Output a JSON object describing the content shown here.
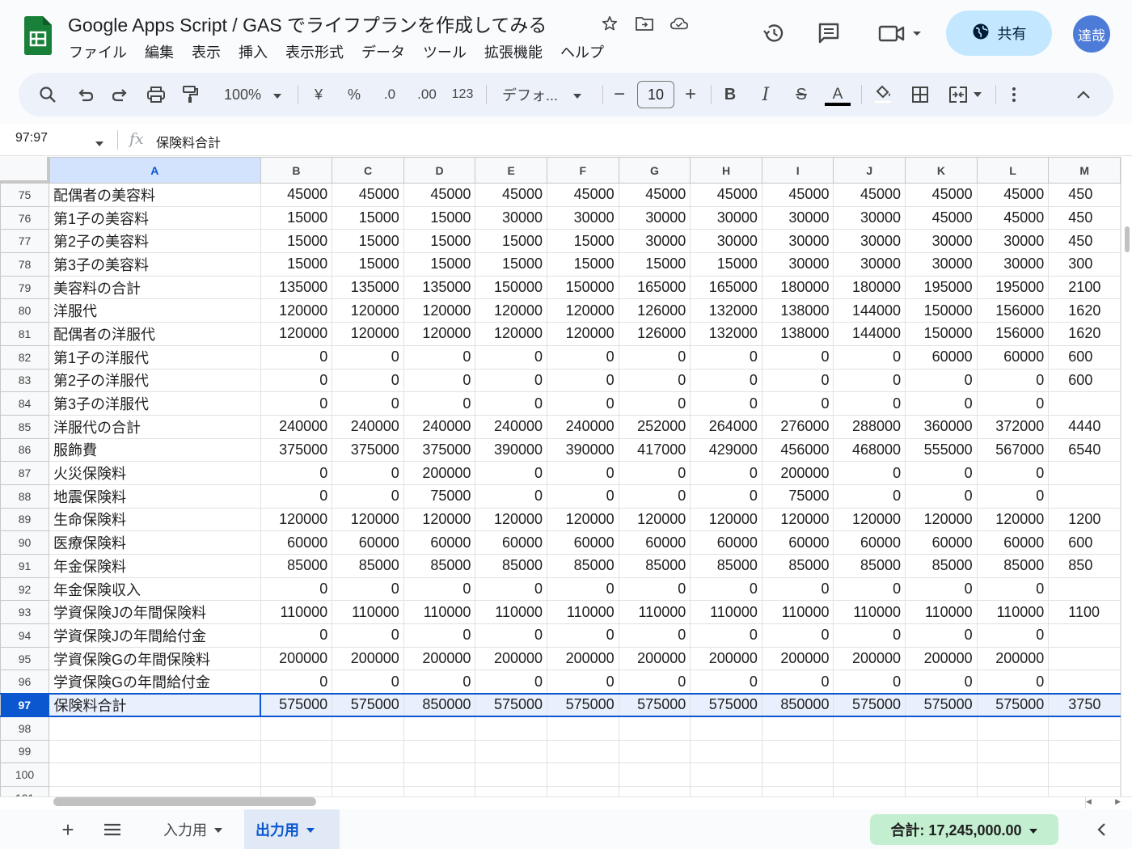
{
  "app": {
    "title": "Google Apps Script / GAS でライフプランを作成してみる",
    "accent_color": "#0b57d0",
    "logo_color": "#188038"
  },
  "menu": [
    "ファイル",
    "編集",
    "表示",
    "挿入",
    "表示形式",
    "データ",
    "ツール",
    "拡張機能",
    "ヘルプ"
  ],
  "header": {
    "share_label": "共有",
    "avatar_text": "達哉",
    "icons": [
      "star-icon",
      "move-to-folder-icon",
      "cloud-saved-icon",
      "history-icon",
      "comment-icon",
      "meet-icon",
      "globe-icon"
    ]
  },
  "toolbar": {
    "zoom": "100%",
    "currency": "¥",
    "percent": "%",
    "dec_decrease": ".0",
    "dec_increase": ".00",
    "number_format": "123",
    "font_family": "デフォ...",
    "font_size": "10",
    "minus": "−",
    "plus": "+",
    "bold": "B",
    "italic": "I",
    "strike": "S",
    "text_color_label": "A"
  },
  "formula_bar": {
    "name_box": "97:97",
    "fx_label": "fx",
    "content": "保険料合計"
  },
  "grid": {
    "columns": [
      "A",
      "B",
      "C",
      "D",
      "E",
      "F",
      "G",
      "H",
      "I",
      "J",
      "K",
      "L",
      "M"
    ],
    "rows": [
      {
        "n": "75",
        "label": "配偶者の美容料",
        "values": [
          "45000",
          "45000",
          "45000",
          "45000",
          "45000",
          "45000",
          "45000",
          "45000",
          "45000",
          "45000",
          "45000",
          "450"
        ]
      },
      {
        "n": "76",
        "label": "第1子の美容料",
        "values": [
          "15000",
          "15000",
          "15000",
          "30000",
          "30000",
          "30000",
          "30000",
          "30000",
          "30000",
          "45000",
          "45000",
          "450"
        ]
      },
      {
        "n": "77",
        "label": "第2子の美容料",
        "values": [
          "15000",
          "15000",
          "15000",
          "15000",
          "15000",
          "30000",
          "30000",
          "30000",
          "30000",
          "30000",
          "30000",
          "450"
        ]
      },
      {
        "n": "78",
        "label": "第3子の美容料",
        "values": [
          "15000",
          "15000",
          "15000",
          "15000",
          "15000",
          "15000",
          "15000",
          "30000",
          "30000",
          "30000",
          "30000",
          "300"
        ]
      },
      {
        "n": "79",
        "label": "美容料の合計",
        "values": [
          "135000",
          "135000",
          "135000",
          "150000",
          "150000",
          "165000",
          "165000",
          "180000",
          "180000",
          "195000",
          "195000",
          "2100"
        ]
      },
      {
        "n": "80",
        "label": "洋服代",
        "values": [
          "120000",
          "120000",
          "120000",
          "120000",
          "120000",
          "126000",
          "132000",
          "138000",
          "144000",
          "150000",
          "156000",
          "1620"
        ]
      },
      {
        "n": "81",
        "label": "配偶者の洋服代",
        "values": [
          "120000",
          "120000",
          "120000",
          "120000",
          "120000",
          "126000",
          "132000",
          "138000",
          "144000",
          "150000",
          "156000",
          "1620"
        ]
      },
      {
        "n": "82",
        "label": "第1子の洋服代",
        "values": [
          "0",
          "0",
          "0",
          "0",
          "0",
          "0",
          "0",
          "0",
          "0",
          "60000",
          "60000",
          "600"
        ]
      },
      {
        "n": "83",
        "label": "第2子の洋服代",
        "values": [
          "0",
          "0",
          "0",
          "0",
          "0",
          "0",
          "0",
          "0",
          "0",
          "0",
          "0",
          "600"
        ]
      },
      {
        "n": "84",
        "label": "第3子の洋服代",
        "values": [
          "0",
          "0",
          "0",
          "0",
          "0",
          "0",
          "0",
          "0",
          "0",
          "0",
          "0",
          ""
        ]
      },
      {
        "n": "85",
        "label": "洋服代の合計",
        "values": [
          "240000",
          "240000",
          "240000",
          "240000",
          "240000",
          "252000",
          "264000",
          "276000",
          "288000",
          "360000",
          "372000",
          "4440"
        ]
      },
      {
        "n": "86",
        "label": "服飾費",
        "values": [
          "375000",
          "375000",
          "375000",
          "390000",
          "390000",
          "417000",
          "429000",
          "456000",
          "468000",
          "555000",
          "567000",
          "6540"
        ]
      },
      {
        "n": "87",
        "label": "火災保険料",
        "values": [
          "0",
          "0",
          "200000",
          "0",
          "0",
          "0",
          "0",
          "200000",
          "0",
          "0",
          "0",
          ""
        ]
      },
      {
        "n": "88",
        "label": "地震保険料",
        "values": [
          "0",
          "0",
          "75000",
          "0",
          "0",
          "0",
          "0",
          "75000",
          "0",
          "0",
          "0",
          ""
        ]
      },
      {
        "n": "89",
        "label": "生命保険料",
        "values": [
          "120000",
          "120000",
          "120000",
          "120000",
          "120000",
          "120000",
          "120000",
          "120000",
          "120000",
          "120000",
          "120000",
          "1200"
        ]
      },
      {
        "n": "90",
        "label": "医療保険料",
        "values": [
          "60000",
          "60000",
          "60000",
          "60000",
          "60000",
          "60000",
          "60000",
          "60000",
          "60000",
          "60000",
          "60000",
          "600"
        ]
      },
      {
        "n": "91",
        "label": "年金保険料",
        "values": [
          "85000",
          "85000",
          "85000",
          "85000",
          "85000",
          "85000",
          "85000",
          "85000",
          "85000",
          "85000",
          "85000",
          "850"
        ]
      },
      {
        "n": "92",
        "label": "年金保険収入",
        "values": [
          "0",
          "0",
          "0",
          "0",
          "0",
          "0",
          "0",
          "0",
          "0",
          "0",
          "0",
          ""
        ]
      },
      {
        "n": "93",
        "label": "学資保険Jの年間保険料",
        "values": [
          "110000",
          "110000",
          "110000",
          "110000",
          "110000",
          "110000",
          "110000",
          "110000",
          "110000",
          "110000",
          "110000",
          "1100"
        ]
      },
      {
        "n": "94",
        "label": "学資保険Jの年間給付金",
        "values": [
          "0",
          "0",
          "0",
          "0",
          "0",
          "0",
          "0",
          "0",
          "0",
          "0",
          "0",
          ""
        ]
      },
      {
        "n": "95",
        "label": "学資保険Gの年間保険料",
        "values": [
          "200000",
          "200000",
          "200000",
          "200000",
          "200000",
          "200000",
          "200000",
          "200000",
          "200000",
          "200000",
          "200000",
          ""
        ]
      },
      {
        "n": "96",
        "label": "学資保険Gの年間給付金",
        "values": [
          "0",
          "0",
          "0",
          "0",
          "0",
          "0",
          "0",
          "0",
          "0",
          "0",
          "0",
          ""
        ]
      },
      {
        "n": "97",
        "label": "保険料合計",
        "values": [
          "575000",
          "575000",
          "850000",
          "575000",
          "575000",
          "575000",
          "575000",
          "850000",
          "575000",
          "575000",
          "575000",
          "3750"
        ],
        "selected": true
      },
      {
        "n": "98",
        "label": "",
        "values": [
          "",
          "",
          "",
          "",
          "",
          "",
          "",
          "",
          "",
          "",
          "",
          ""
        ]
      },
      {
        "n": "99",
        "label": "",
        "values": [
          "",
          "",
          "",
          "",
          "",
          "",
          "",
          "",
          "",
          "",
          "",
          ""
        ]
      },
      {
        "n": "100",
        "label": "",
        "values": [
          "",
          "",
          "",
          "",
          "",
          "",
          "",
          "",
          "",
          "",
          "",
          ""
        ]
      },
      {
        "n": "101",
        "label": "",
        "values": [
          "",
          "",
          "",
          "",
          "",
          "",
          "",
          "",
          "",
          "",
          "",
          ""
        ]
      }
    ]
  },
  "sheets": {
    "tabs": [
      {
        "label": "入力用",
        "active": false
      },
      {
        "label": "出力用",
        "active": true
      }
    ],
    "sum_label": "合計: 17,245,000.00"
  }
}
